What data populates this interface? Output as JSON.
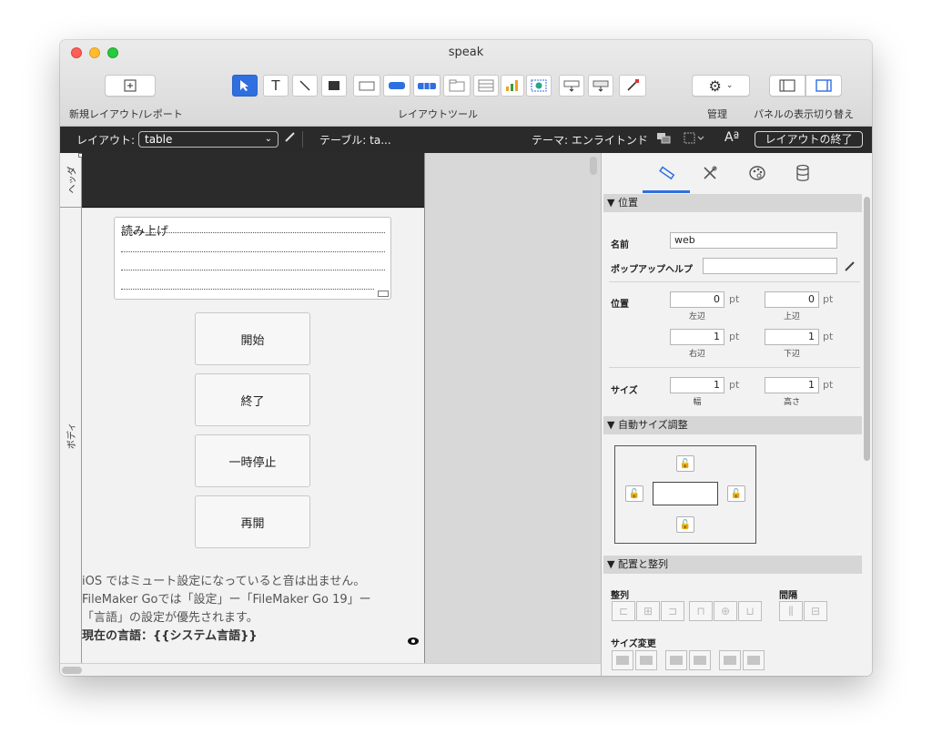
{
  "window": {
    "title": "speak"
  },
  "toolbar": {
    "new_layout_label": "新規レイアウト/レポート",
    "layout_tools_label": "レイアウトツール",
    "manage_label": "管理",
    "panel_toggle_label": "パネルの表示切り替え",
    "text_tool_glyph": "T"
  },
  "layout_bar": {
    "layout_label": "レイアウト:",
    "layout_value": "table",
    "table_label": "テーブル: ta...",
    "theme_label": "テーマ: エンライトンド",
    "exit_layout_button": "レイアウトの終了",
    "aa_glyph": "Aª"
  },
  "parts": {
    "header": "ヘッダ",
    "body": "ボディ"
  },
  "layout": {
    "webviewer_title": "読み上げ",
    "buttons": [
      "開始",
      "終了",
      "一時停止",
      "再開"
    ],
    "note_line1": "iOS ではミュート設定になっていると音は出ません。",
    "note_line2": "FileMaker Goでは「設定」ー「FileMaker Go 19」ー",
    "note_line3": "「言語」の設定が優先されます。",
    "note_line4": "現在の言語：{{システム言語}}"
  },
  "inspector": {
    "tabs": [
      "ruler-icon",
      "tools-icon",
      "palette-icon",
      "database-icon"
    ],
    "section_position": "▼ 位置",
    "name_label": "名前",
    "name_value": "web",
    "popup_help_label": "ポップアップヘルプ",
    "popup_help_value": "",
    "position_label": "位置",
    "left": {
      "value": "0",
      "unit": "pt",
      "caption": "左辺"
    },
    "top": {
      "value": "0",
      "unit": "pt",
      "caption": "上辺"
    },
    "right": {
      "value": "1",
      "unit": "pt",
      "caption": "右辺"
    },
    "bottom": {
      "value": "1",
      "unit": "pt",
      "caption": "下辺"
    },
    "size_label": "サイズ",
    "width": {
      "value": "1",
      "unit": "pt",
      "caption": "幅"
    },
    "height": {
      "value": "1",
      "unit": "pt",
      "caption": "高さ"
    },
    "section_autosize": "▼ 自動サイズ調整",
    "section_arrange": "▼ 配置と整列",
    "align_label": "整列",
    "spacing_label": "間隔",
    "resize_label": "サイズ変更"
  }
}
